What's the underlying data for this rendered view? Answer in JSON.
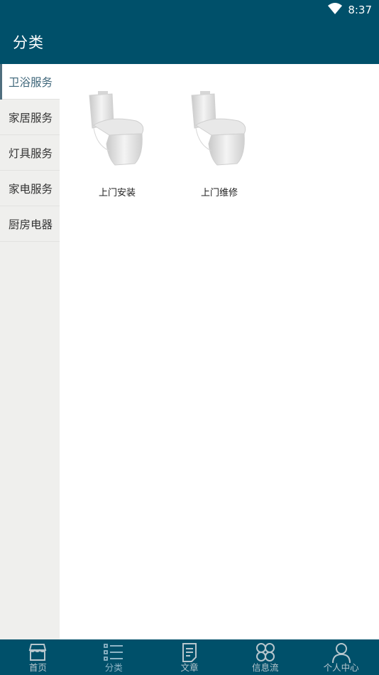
{
  "status_bar": {
    "time": "8:37",
    "wifi_icon": "wifi-icon"
  },
  "app_bar": {
    "title": "分类"
  },
  "sidebar": {
    "items": [
      {
        "label": "卫浴服务",
        "active": true
      },
      {
        "label": "家居服务"
      },
      {
        "label": "灯具服务"
      },
      {
        "label": "家电服务"
      },
      {
        "label": "厨房电器"
      }
    ]
  },
  "content": {
    "items": [
      {
        "label": "上门安装",
        "image": "toilet-image"
      },
      {
        "label": "上门维修",
        "image": "toilet-image"
      }
    ]
  },
  "bottom_nav": {
    "items": [
      {
        "label": "首页",
        "icon": "store-icon"
      },
      {
        "label": "分类",
        "icon": "list-icon",
        "active": true
      },
      {
        "label": "文章",
        "icon": "document-icon"
      },
      {
        "label": "信息流",
        "icon": "grid-circles-icon"
      },
      {
        "label": "个人中心",
        "icon": "person-icon"
      }
    ]
  },
  "colors": {
    "primary": "#00506a",
    "sidebar_bg": "#efefed",
    "active_text": "#3c6478"
  }
}
